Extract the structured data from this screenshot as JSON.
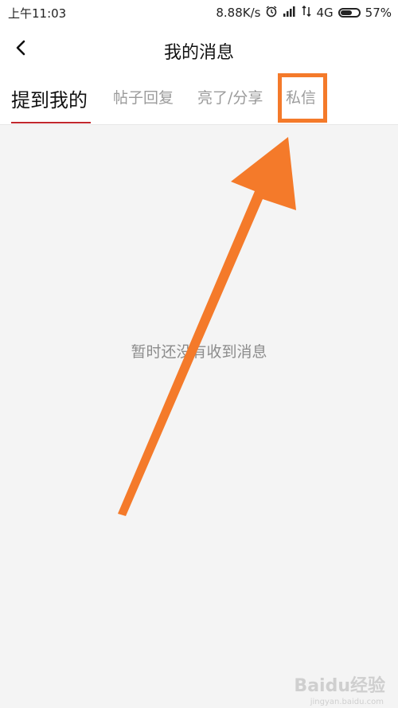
{
  "status_bar": {
    "time": "上午11:03",
    "net_speed": "8.88K/s",
    "network": "4G",
    "battery": "57%"
  },
  "header": {
    "title": "我的消息"
  },
  "tabs": [
    {
      "label": "提到我的",
      "active": true
    },
    {
      "label": "帖子回复",
      "active": false
    },
    {
      "label": "亮了/分享",
      "active": false
    },
    {
      "label": "私信",
      "active": false
    }
  ],
  "empty_state": {
    "text": "暂时还没有收到消息"
  },
  "watermark": {
    "brand": "Baidu经验",
    "url": "jingyan.baidu.com"
  },
  "colors": {
    "accent": "#c1272d",
    "annotation": "#f47a2a"
  }
}
